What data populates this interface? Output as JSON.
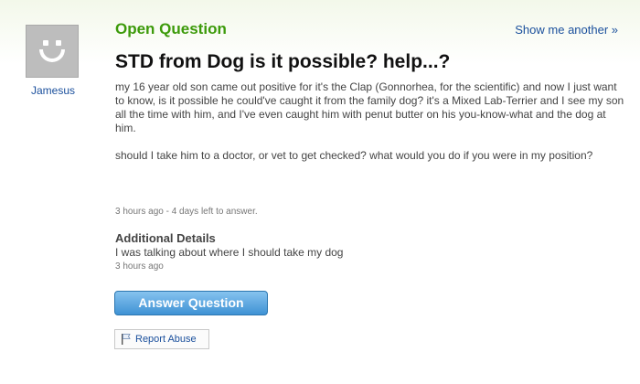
{
  "user": {
    "name": "Jamesus",
    "avatar_icon": "default-smiley-avatar"
  },
  "header": {
    "status_label": "Open Question",
    "show_another": "Show me another »"
  },
  "question": {
    "title": "STD from Dog is it possible? help...?",
    "paragraphs": [
      "my 16 year old son came out positive for it's the Clap (Gonnorhea, for the scientific) and now I just want to know, is it possible he could've caught it from the family dog? it's a Mixed Lab-Terrier and I see my son all the time with him, and I've even caught him with penut butter on his you-know-what and the dog at him.",
      "should I take him to a doctor, or vet to get checked? what would you do if you were in my position?"
    ],
    "meta": "3 hours ago - 4 days left to answer."
  },
  "additional_details": {
    "heading": "Additional Details",
    "text": "I was talking about where I should take my dog",
    "meta": "3 hours ago"
  },
  "actions": {
    "answer_label": "Answer Question",
    "report_label": "Report Abuse",
    "report_icon": "flag-icon"
  },
  "colors": {
    "status_green": "#3c9a0a",
    "link_blue": "#1a4f9c",
    "button_blue": "#3f92d4"
  }
}
